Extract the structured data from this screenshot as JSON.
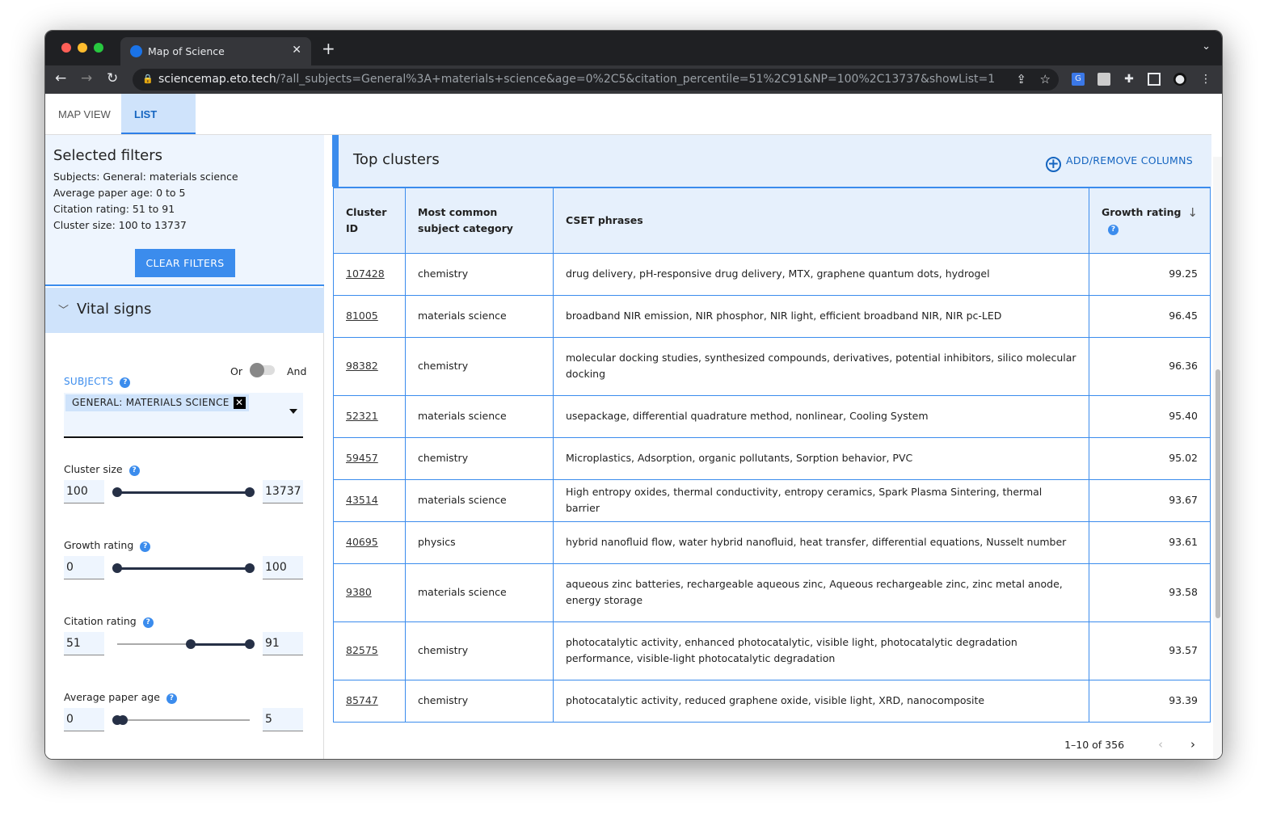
{
  "browser": {
    "tab_title": "Map of Science",
    "url_host": "sciencemap.eto.tech",
    "url_rest": "/?all_subjects=General%3A+materials+science&age=0%2C5&citation_percentile=51%2C91&NP=100%2C13737&showList=1"
  },
  "views": {
    "tabs": [
      {
        "label": "MAP VIEW",
        "active": false
      },
      {
        "label": "LIST VIEW",
        "active": true
      }
    ]
  },
  "filters": {
    "title": "Selected filters",
    "lines": [
      "Subjects: General: materials science",
      "Average paper age: 0 to 5",
      "Citation rating: 51 to 91",
      "Cluster size: 100 to 13737"
    ],
    "clear_label": "CLEAR FILTERS"
  },
  "vital": {
    "title": "Vital signs",
    "toggle_or": "Or",
    "toggle_and": "And",
    "subjects_label": "SUBJECTS",
    "subject_chip": "GENERAL: MATERIALS SCIENCE",
    "sliders": [
      {
        "label": "Cluster size",
        "min": "100",
        "max": "13737",
        "thumbs": [
          0,
          1
        ]
      },
      {
        "label": "Growth rating",
        "min": "0",
        "max": "100",
        "thumbs": [
          0,
          1
        ]
      },
      {
        "label": "Citation rating",
        "min": "51",
        "max": "91",
        "thumbs": [
          0.555,
          1
        ]
      },
      {
        "label": "Average paper age",
        "min": "0",
        "max": "5",
        "thumbs": [
          0,
          0.04
        ]
      }
    ]
  },
  "clusters": {
    "title": "Top clusters",
    "add_remove": "ADD/REMOVE COLUMNS",
    "columns": [
      "Cluster ID",
      "Most common subject category",
      "CSET phrases",
      "Growth rating"
    ],
    "rows": [
      [
        "107428",
        "chemistry",
        "drug delivery, pH-responsive drug delivery, MTX, graphene quantum dots, hydrogel",
        "99.25"
      ],
      [
        "81005",
        "materials science",
        "broadband NIR emission, NIR phosphor, NIR light, efficient broadband NIR, NIR pc-LED",
        "96.45"
      ],
      [
        "98382",
        "chemistry",
        "molecular docking studies, synthesized compounds, derivatives, potential inhibitors, silico molecular docking",
        "96.36"
      ],
      [
        "52321",
        "materials science",
        "usepackage, differential quadrature method, nonlinear, Cooling System",
        "95.40"
      ],
      [
        "59457",
        "chemistry",
        "Microplastics, Adsorption, organic pollutants, Sorption behavior, PVC",
        "95.02"
      ],
      [
        "43514",
        "materials science",
        "High entropy oxides, thermal conductivity, entropy ceramics, Spark Plasma Sintering, thermal barrier",
        "93.67"
      ],
      [
        "40695",
        "physics",
        "hybrid nanofluid flow, water hybrid nanofluid, heat transfer, differential equations, Nusselt number",
        "93.61"
      ],
      [
        "9380",
        "materials science",
        "aqueous zinc batteries, rechargeable aqueous zinc, Aqueous rechargeable zinc, zinc metal anode, energy storage",
        "93.58"
      ],
      [
        "82575",
        "chemistry",
        "photocatalytic activity, enhanced photocatalytic, visible light, photocatalytic degradation performance, visible-light photocatalytic degradation",
        "93.57"
      ],
      [
        "85747",
        "chemistry",
        "photocatalytic activity, reduced graphene oxide, visible light, XRD, nanocomposite",
        "93.39"
      ]
    ],
    "pagination": "1–10 of 356"
  },
  "colors": {
    "accent": "#3b8ced",
    "link": "#1565c0",
    "panel": "#eef5fe",
    "header": "#cfe3fb"
  }
}
